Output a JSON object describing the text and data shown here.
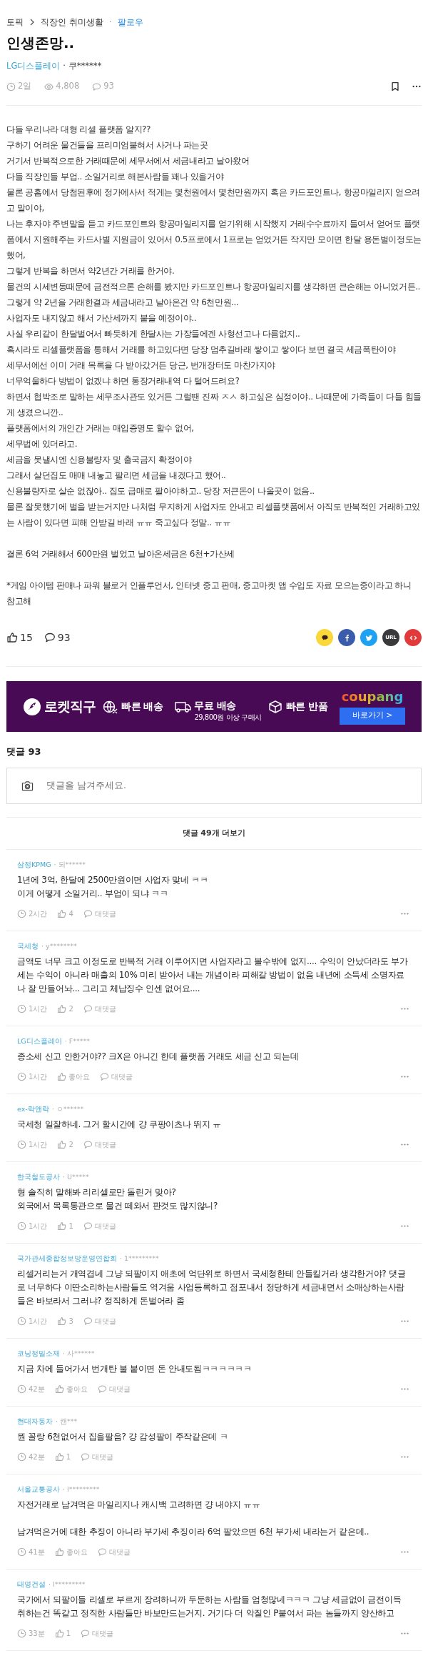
{
  "breadcrumb": {
    "section": "토픽",
    "topic": "직장인 취미생활",
    "separator": "·",
    "follow": "팔로우"
  },
  "post": {
    "title": "인생존망..",
    "company": "LG디스플레이",
    "user": "· 쿠******",
    "time": "2일",
    "views": "4,808",
    "comments": "93",
    "paragraphs": [
      [
        "다들 우리나라 대형 리셀 플랫폼 알지??",
        "구하기 어려운 물건들을 프리미엄붙혀서 사거나 파는곳",
        "거기서 반복적으로한 거래때문에 세무서에서 세금내라고 날아왔어",
        "다들 직장인들 부업.. 소일거리로 해본사람들 꽤나 있을거야",
        "물론 공홈에서 당첨된후에 정가에사서 적게는 몇천원에서 몇천만원까지 혹은 카드포인트나, 항공마일리지 얻으려고 말이야,",
        "나는 후자야 주변말을 듣고 카드포인트와 항공마일리지를 얻기위해 시작했지 거래수수료까지 들여서 얻어도 플랫폼에서 지원해주는 카드사별 지원금이 있어서 0.5프로에서 1프로는 얻었거든 작지만 모이면 한달 용돈벌이정도는 했어,",
        "그렇게 반복을 하면서 약2년간 거래를 한거야.",
        "물건의 시세변동때문에 금전적으론 손해를 봤지만 카드포인트나 항공마일리지를 생각하면 큰손해는 아니었거든..",
        "그렇게 약 2년을 거래한결과 세금내라고 날아온건 약 6천만원...",
        "사업자도 내지않고 해서 가산세까지 붙을 예정이야..",
        "사실 우리같이 한달벌어서 빠듯하게 한달사는 가장들에겐 사형선고나 다름없지..",
        "혹시라도 리셀플랫폼을 통해서 거래를 하고있다면 당장 멈추길바래 쌓이고 쌓이다 보면 결국 세금폭탄이야",
        "세무서에선 이미 거래 목록을 다 받아갔거든 당근, 번개장터도 마찬가지야",
        "너무억울하다 방법이 없겠냐 하면 통장거래내역 다 털어드려요?",
        "하면서 협박조로 말하는 세무조사관도 있거든 그럴땐 진짜 ㅈㅅ 하고싶은 심정이야.. 나때문에 가족들이 다들 힘들게 생겼으니깐..",
        "플랫폼에서의 개인간 거래는 매입증명도 할수 없어,",
        "세무법에 있더라고.",
        "세금을 못낼시엔 신용불량자 및 출국금지 확정이야",
        "그래서 살던집도 매매 내놓고 팔리면 세금을 내겠다고 했어..",
        "신용불량자로 살순 없잖아.. 집도 급매로 팔아야하고.. 당장 저큰돈이 나올곳이 없음..",
        "물론 잘못했기에 벌을 받는거지만 나처럼 무지하게 사업자도 안내고 리셀플랫폼에서 아직도 반복적인 거래하고있는 사람이 있다면 피해 안받길 바래 ㅠㅠ 죽고싶다 정말.. ㅠㅠ"
      ],
      [
        "결론 6억 거래해서 600만원 벌었고 날아온세금은 6천+가산세"
      ],
      [
        "*게임 아이템 판매나 파워 블로거 인플루언서, 인터넷 중고 판매, 중고마켓 앱 수입도 자료 모으는중이라고 하니 참고해"
      ]
    ],
    "likes": "15",
    "comment_count": "93"
  },
  "share": [
    {
      "kind": "kakao",
      "color": "#fad83a"
    },
    {
      "kind": "facebook",
      "color": "#3b5bab"
    },
    {
      "kind": "twitter",
      "color": "#1da1f2"
    },
    {
      "kind": "url",
      "color": "#3a3a3c",
      "label": "URL"
    },
    {
      "kind": "embed",
      "color": "#e23a3a"
    }
  ],
  "ad": {
    "brand_title": "로켓직구",
    "feature_1": "빠른 배송",
    "feature_2": "무료 배송",
    "feature_2_note": "29,800원 이상 구매시",
    "feature_3": "빠른 반품",
    "logo": "coupang",
    "button": "바로가기 >"
  },
  "comments_header": "댓글 93",
  "comment_input": {
    "placeholder": "댓글을 남겨주세요."
  },
  "more_comments": "댓글 49개 더보기",
  "comments": [
    {
      "company": "삼정KPMG",
      "user": "· 되******",
      "paragraphs": [
        [
          "1년에 3억, 한달에 2500만원이면 사업자 맞네 ㅋㅋ",
          "이게 어떻게 소일거리.. 부업이 되냐 ㅋㅋ"
        ]
      ],
      "time": "2시간",
      "likes": "4",
      "reply": "대댓글"
    },
    {
      "company": "국세청",
      "user": "· y********",
      "paragraphs": [
        [
          "금액도 너무 크고 이정도로 반복적 거래 이루어지면 사업자라고 볼수밖에 없지.... 수익이 안났더라도 부가세는 수익이 아니라 매출의 10% 미리 받아서 내는 개념이라 피해갈 방법이 없음 내년에 소득세 소명자료나 잘 만들어놔... 그리고 체납징수 인센 없어요...."
        ]
      ],
      "time": "1시간",
      "likes": "2",
      "reply": "대댓글"
    },
    {
      "company": "LG디스플레이",
      "user": "· F*****",
      "paragraphs": [
        [
          "종소세 신고 안한거야?? 크X은 아니긴 한데 플랫폼 거래도 세금 신고 되는데"
        ]
      ],
      "time": "1시간",
      "likes": "좋아요",
      "reply": "대댓글"
    },
    {
      "company": "ex-락앤락",
      "user": "· ㅇ******",
      "paragraphs": [
        [
          "국세청 일잘하네. 그거 할시간에 걍 쿠팡이츠나 뛰지 ㅠ"
        ]
      ],
      "time": "1시간",
      "likes": "2",
      "reply": "대댓글"
    },
    {
      "company": "한국철도공사",
      "user": "· U*****",
      "paragraphs": [
        [
          "형 솔직히 말해봐 리리셀로만 돌린거 맞아?",
          "외국에서 목록통관으로 물건 떼와서 판것도 많지않니?"
        ]
      ],
      "time": "1시간",
      "likes": "1",
      "reply": "대댓글"
    },
    {
      "company": "국가관세종합정보망운영연합회",
      "user": "· 1*********",
      "paragraphs": [
        [
          "리셀거리는거 개역겹네 그냥 되팔이지 애초에 억단위로 하면서 국세청한테 안들킬거라 생각한거야? 댓글로 너무하다 이딴소리하는사람들도 역겨움 사업등록하고 점포내서 정당하게 세금내면서 소매상하는사람들은 바보라서 그러냐? 정직하게 돈벌어라 좀"
        ]
      ],
      "time": "1시간",
      "likes": "3",
      "reply": "대댓글"
    },
    {
      "company": "코닝정밀소재",
      "user": "· 사******",
      "paragraphs": [
        [
          "지금 차에 들어가서 번개탄 불 붙이면 돈 안내도됨ㅋㅋㅋㅋㅋㅋ"
        ]
      ],
      "time": "42분",
      "likes": "좋아요",
      "reply": "대댓글"
    },
    {
      "company": "현대자동차",
      "user": "· 캔***",
      "paragraphs": [
        [
          "뭔 꼴랑 6천없어서 집을팔음? 걍 감성팔이 주작같은데 ㅋ"
        ]
      ],
      "time": "42분",
      "likes": "1",
      "reply": "대댓글"
    },
    {
      "company": "서울교통공사",
      "user": "· l*********",
      "paragraphs": [
        [
          "자전거래로 남겨먹은 마일리지나 캐시백 고려하면 걍 내야지 ㅠㅠ"
        ],
        [
          "남겨먹은거에 대한 추징이 아니라 부가세 추징이라 6억 팔았으면 6천 부가세 내라는거 같은데.."
        ]
      ],
      "time": "41분",
      "likes": "좋아요",
      "reply": "대댓글"
    },
    {
      "company": "태영건설",
      "user": "· l*********",
      "paragraphs": [
        [
          "국가에서 되팔이들 리셀로 부르게 장려하니까 두둔하는 사람들 엄청많네ㅋㅋㅋ 그냥 세금없이 금전이득 취하는건 똑같고 정직한 사람들만 바보만드는거지. 거기다 더 악질인 P붙여서 파는 놈들까지 양산하고"
        ]
      ],
      "time": "33분",
      "likes": "1",
      "reply": "대댓글"
    }
  ]
}
